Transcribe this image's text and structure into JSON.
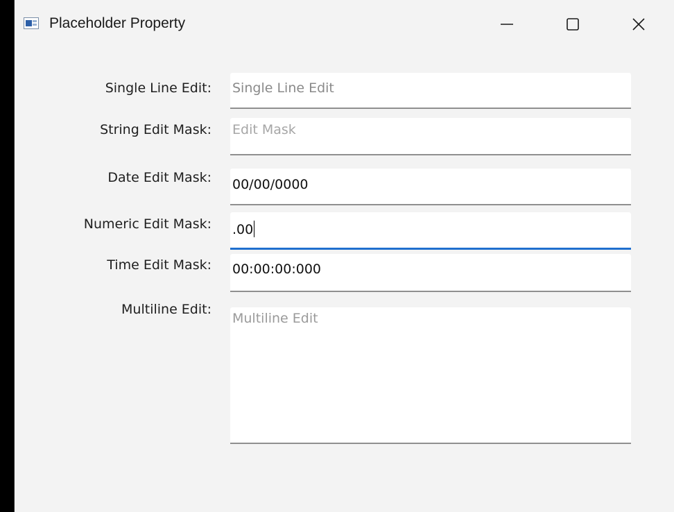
{
  "window": {
    "title": "Placeholder Property",
    "controls": {
      "minimize": "minimize-icon",
      "maximize": "maximize-icon",
      "close": "close-icon"
    }
  },
  "form": {
    "single_line": {
      "label": "Single Line Edit:",
      "value": "",
      "placeholder": "Single Line Edit"
    },
    "string_mask": {
      "label": "String Edit Mask:",
      "value": "",
      "placeholder": "Edit Mask"
    },
    "date_mask": {
      "label": "Date Edit Mask:",
      "value": "00/00/0000"
    },
    "numeric_mask": {
      "label": "Numeric Edit Mask:",
      "value": ".00",
      "focused": true
    },
    "time_mask": {
      "label": "Time Edit Mask:",
      "value": "00:00:00:000"
    },
    "multiline": {
      "label": "Multiline Edit:",
      "value": "",
      "placeholder": "Multiline Edit"
    }
  },
  "colors": {
    "window_bg": "#f3f3f3",
    "focus_accent": "#1f6fce",
    "placeholder_text": "#8a8a8a"
  }
}
